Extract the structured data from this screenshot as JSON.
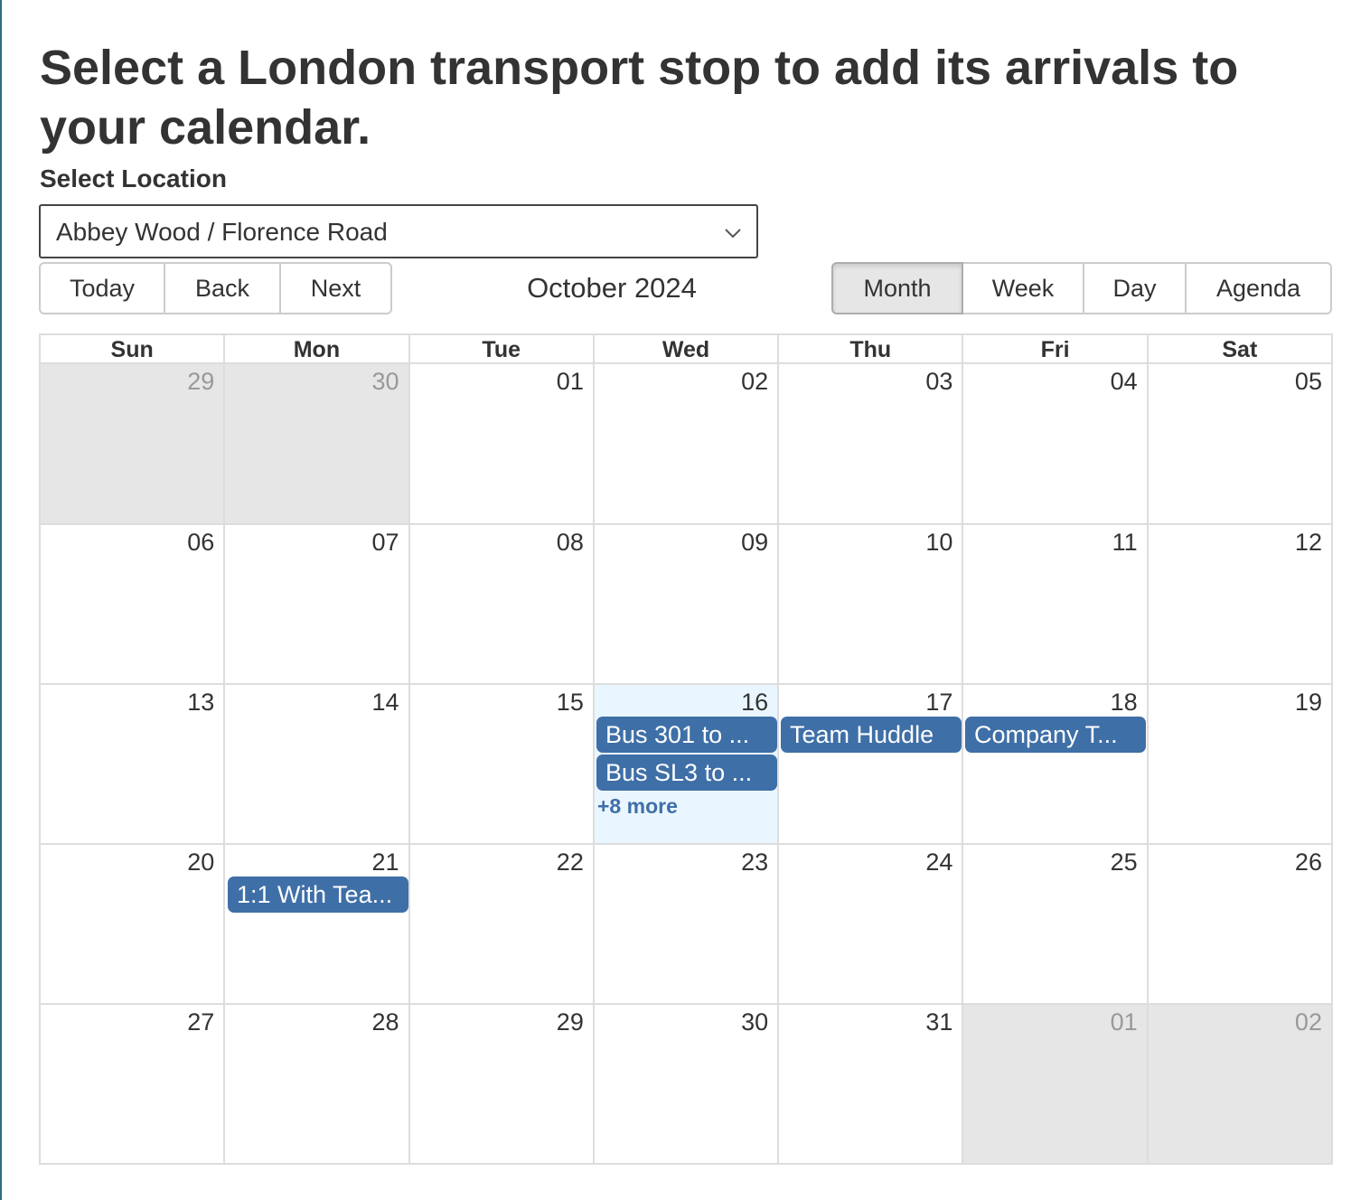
{
  "heading": "Select a London transport stop to add its arrivals to your calendar.",
  "location": {
    "label": "Select Location",
    "selected": "Abbey Wood / Florence Road"
  },
  "toolbar": {
    "today": "Today",
    "back": "Back",
    "next": "Next",
    "month_label": "October 2024",
    "views": {
      "month": "Month",
      "week": "Week",
      "day": "Day",
      "agenda": "Agenda"
    },
    "active_view": "Month"
  },
  "calendar": {
    "weekdays": [
      "Sun",
      "Mon",
      "Tue",
      "Wed",
      "Thu",
      "Fri",
      "Sat"
    ],
    "weeks": [
      [
        "29",
        "30",
        "01",
        "02",
        "03",
        "04",
        "05"
      ],
      [
        "06",
        "07",
        "08",
        "09",
        "10",
        "11",
        "12"
      ],
      [
        "13",
        "14",
        "15",
        "16",
        "17",
        "18",
        "19"
      ],
      [
        "20",
        "21",
        "22",
        "23",
        "24",
        "25",
        "26"
      ],
      [
        "27",
        "28",
        "29",
        "30",
        "31",
        "01",
        "02"
      ]
    ],
    "events": {
      "wed16_a": "Bus 301 to ...",
      "wed16_b": "Bus SL3 to ...",
      "wed16_more": "+8 more",
      "thu17": "Team Huddle",
      "fri18": "Company T...",
      "mon21": "1:1 With Tea..."
    }
  },
  "colors": {
    "event": "#3f6fa7",
    "today_bg": "#eaf6ff",
    "off_range_bg": "#e6e6e6",
    "border": "#dddddd"
  }
}
